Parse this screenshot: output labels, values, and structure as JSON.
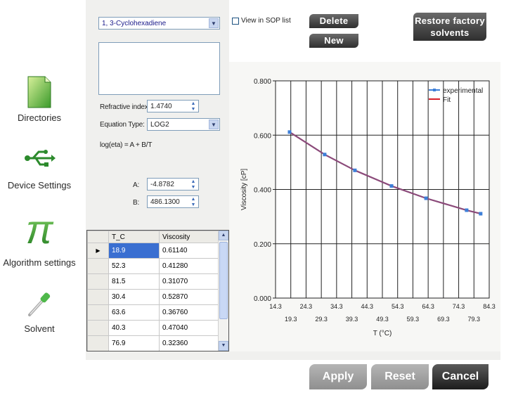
{
  "nav": {
    "items": [
      {
        "label": "Directories",
        "icon": "folder-icon"
      },
      {
        "label": "Device Settings",
        "icon": "usb-icon"
      },
      {
        "label": "Algorithm settings",
        "icon": "pi-icon"
      },
      {
        "label": "Solvent",
        "icon": "pipette-icon"
      }
    ]
  },
  "solvent": {
    "selected": "1, 3-Cyclohexadiene",
    "view_in_sop_label": "View in SOP list",
    "view_in_sop_checked": false,
    "description": ""
  },
  "buttons": {
    "delete": "Delete",
    "new": "New",
    "restore_line1": "Restore factory",
    "restore_line2": "solvents",
    "apply": "Apply",
    "reset": "Reset",
    "cancel": "Cancel"
  },
  "form": {
    "refractive_index_label": "Refractive index:",
    "refractive_index_value": "1.4740",
    "equation_type_label": "Equation Type:",
    "equation_type_value": "LOG2",
    "equation_formula": "log(eta) = A + B/T",
    "a_label": "A:",
    "a_value": "-4.8782",
    "b_label": "B:",
    "b_value": "486.1300"
  },
  "table": {
    "headers": [
      "T_C",
      "Viscosity"
    ],
    "rows": [
      [
        "18.9",
        "0.61140"
      ],
      [
        "52.3",
        "0.41280"
      ],
      [
        "81.5",
        "0.31070"
      ],
      [
        "30.4",
        "0.52870"
      ],
      [
        "63.6",
        "0.36760"
      ],
      [
        "40.3",
        "0.47040"
      ],
      [
        "76.9",
        "0.32360"
      ]
    ],
    "selected_row": 0
  },
  "chart_data": {
    "type": "line",
    "xlabel": "T (°C)",
    "ylabel": "Viscosity [cP]",
    "xlim": [
      14.3,
      84.3
    ],
    "ylim": [
      0.0,
      0.8
    ],
    "x_ticks_top": [
      "14.3",
      "24.3",
      "34.3",
      "44.3",
      "54.3",
      "64.3",
      "74.3",
      "84.3"
    ],
    "x_ticks_bottom": [
      "19.3",
      "29.3",
      "39.3",
      "49.3",
      "59.3",
      "69.3",
      "79.3"
    ],
    "y_ticks": [
      "0.000",
      "0.200",
      "0.400",
      "0.600",
      "0.800"
    ],
    "grid": true,
    "legend_position": "top-right",
    "series": [
      {
        "name": "experimental",
        "color": "#3d7fd8",
        "x": [
          18.9,
          30.4,
          40.3,
          52.3,
          63.6,
          76.9,
          81.5
        ],
        "y": [
          0.6114,
          0.5287,
          0.4704,
          0.4128,
          0.3676,
          0.3236,
          0.3107
        ]
      },
      {
        "name": "Fit",
        "color": "#d8202a",
        "x": [
          18.9,
          30.4,
          40.3,
          52.3,
          63.6,
          76.9,
          81.5
        ],
        "y": [
          0.6114,
          0.5287,
          0.4704,
          0.4128,
          0.3676,
          0.3236,
          0.3107
        ]
      }
    ]
  }
}
